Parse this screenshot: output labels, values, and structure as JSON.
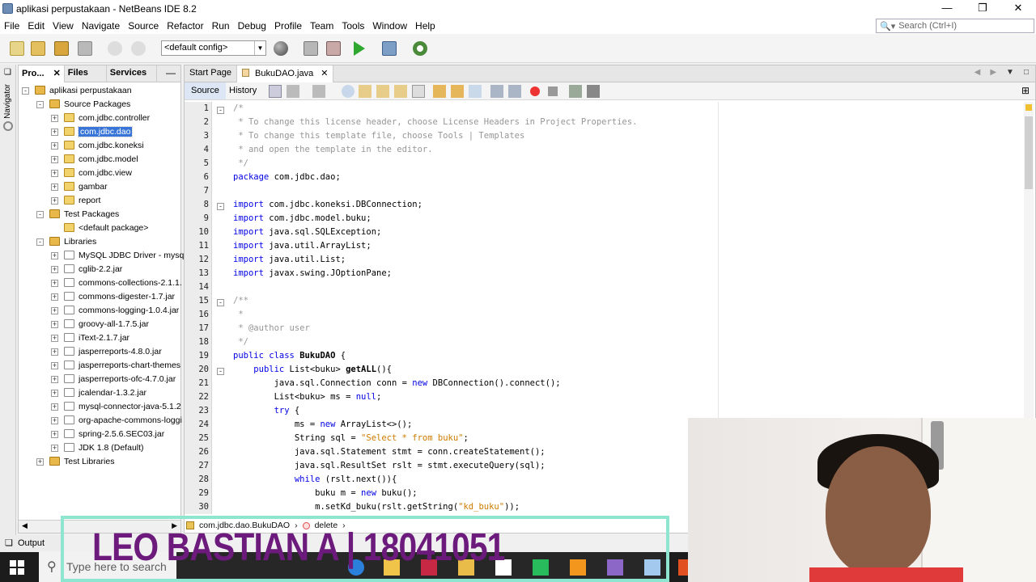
{
  "window": {
    "title": "aplikasi perpustakaan - NetBeans IDE 8.2"
  },
  "menu": [
    "File",
    "Edit",
    "View",
    "Navigate",
    "Source",
    "Refactor",
    "Run",
    "Debug",
    "Profile",
    "Team",
    "Tools",
    "Window",
    "Help"
  ],
  "search": {
    "placeholder": "Search (Ctrl+I)"
  },
  "toolbar": {
    "config": "<default config>"
  },
  "side": {
    "navigator": "Navigator"
  },
  "project_panel": {
    "tabs": [
      "Pro...",
      "Files",
      "Services"
    ],
    "tree": [
      {
        "label": "aplikasi perpustakaan",
        "icon": "project-icon"
      },
      {
        "label": "Source Packages",
        "icon": "folder-icon"
      },
      {
        "label": "com.jdbc.controller",
        "icon": "package-icon"
      },
      {
        "label": "com.jdbc.dao",
        "icon": "package-icon",
        "selected": true
      },
      {
        "label": "com.jdbc.koneksi",
        "icon": "package-icon"
      },
      {
        "label": "com.jdbc.model",
        "icon": "package-icon"
      },
      {
        "label": "com.jdbc.view",
        "icon": "package-icon"
      },
      {
        "label": "gambar",
        "icon": "package-icon"
      },
      {
        "label": "report",
        "icon": "package-icon"
      },
      {
        "label": "Test Packages",
        "icon": "folder-icon"
      },
      {
        "label": "<default package>",
        "icon": "package-icon"
      },
      {
        "label": "Libraries",
        "icon": "folder-icon"
      },
      {
        "label": "MySQL JDBC Driver - mysql",
        "icon": "jar-icon"
      },
      {
        "label": "cglib-2.2.jar",
        "icon": "jar-icon"
      },
      {
        "label": "commons-collections-2.1.1.",
        "icon": "jar-icon"
      },
      {
        "label": "commons-digester-1.7.jar",
        "icon": "jar-icon"
      },
      {
        "label": "commons-logging-1.0.4.jar",
        "icon": "jar-icon"
      },
      {
        "label": "groovy-all-1.7.5.jar",
        "icon": "jar-icon"
      },
      {
        "label": "iText-2.1.7.jar",
        "icon": "jar-icon"
      },
      {
        "label": "jasperreports-4.8.0.jar",
        "icon": "jar-icon"
      },
      {
        "label": "jasperreports-chart-themes",
        "icon": "jar-icon"
      },
      {
        "label": "jasperreports-ofc-4.7.0.jar",
        "icon": "jar-icon"
      },
      {
        "label": "jcalendar-1.3.2.jar",
        "icon": "jar-icon"
      },
      {
        "label": "mysql-connector-java-5.1.2",
        "icon": "jar-icon"
      },
      {
        "label": "org-apache-commons-loggi",
        "icon": "jar-icon"
      },
      {
        "label": "spring-2.5.6.SEC03.jar",
        "icon": "jar-icon"
      },
      {
        "label": "JDK 1.8 (Default)",
        "icon": "jdk-icon"
      },
      {
        "label": "Test Libraries",
        "icon": "folder-icon"
      }
    ]
  },
  "editor": {
    "tabs": [
      "Start Page",
      "BukuDAO.java"
    ],
    "sub_tabs": [
      "Source",
      "History"
    ],
    "lines": [
      {
        "n": "1",
        "t": "/*"
      },
      {
        "n": "2",
        "t": " * To change this license header, choose License Headers in Project Properties."
      },
      {
        "n": "3",
        "t": " * To change this template file, choose Tools | Templates"
      },
      {
        "n": "4",
        "t": " * and open the template in the editor."
      },
      {
        "n": "5",
        "t": " */"
      },
      {
        "n": "6",
        "t": "package com.jdbc.dao;"
      },
      {
        "n": "7",
        "t": ""
      },
      {
        "n": "8",
        "t": "import com.jdbc.koneksi.DBConnection;"
      },
      {
        "n": "9",
        "t": "import com.jdbc.model.buku;"
      },
      {
        "n": "10",
        "t": "import java.sql.SQLException;"
      },
      {
        "n": "11",
        "t": "import java.util.ArrayList;"
      },
      {
        "n": "12",
        "t": "import java.util.List;"
      },
      {
        "n": "13",
        "t": "import javax.swing.JOptionPane;"
      },
      {
        "n": "14",
        "t": ""
      },
      {
        "n": "15",
        "t": "/**"
      },
      {
        "n": "16",
        "t": " *"
      },
      {
        "n": "17",
        "t": " * @author user"
      },
      {
        "n": "18",
        "t": " */"
      },
      {
        "n": "19",
        "t": "public class BukuDAO {"
      },
      {
        "n": "20",
        "t": "    public List<buku> getALL(){"
      },
      {
        "n": "21",
        "t": "        java.sql.Connection conn = new DBConnection().connect();"
      },
      {
        "n": "22",
        "t": "        List<buku> ms = null;"
      },
      {
        "n": "23",
        "t": "        try {"
      },
      {
        "n": "24",
        "t": "            ms = new ArrayList<>();"
      },
      {
        "n": "25",
        "t": "            String sql = \"Select * from buku\";"
      },
      {
        "n": "26",
        "t": "            java.sql.Statement stmt = conn.createStatement();"
      },
      {
        "n": "27",
        "t": "            java.sql.ResultSet rslt = stmt.executeQuery(sql);"
      },
      {
        "n": "28",
        "t": "            while (rslt.next()){"
      },
      {
        "n": "29",
        "t": "                buku m = new buku();"
      },
      {
        "n": "30",
        "t": "                m.setKd_buku(rslt.getString(\"kd_buku\"));"
      }
    ],
    "breadcrumb": [
      "com.jdbc.dao.BukuDAO",
      "delete"
    ]
  },
  "bottom": {
    "output_tab": "Output"
  },
  "overlay": {
    "banner_text": "LEO BASTIAN A  |  18041051"
  },
  "taskbar": {
    "search_placeholder": "Type here to search"
  },
  "colors": {
    "keyword": "#0000e6",
    "comment": "#969696",
    "string": "#ce7b00",
    "selection": "#3875d7",
    "banner_border": "#8ee5d0",
    "banner_text": "#6c1a7c"
  }
}
